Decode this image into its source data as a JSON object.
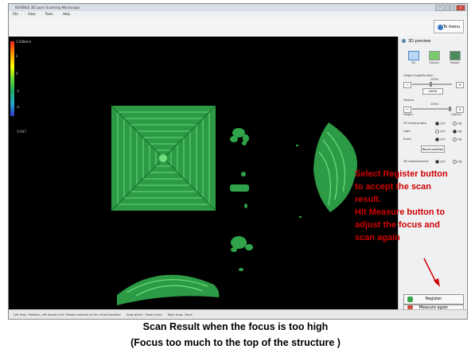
{
  "window": {
    "title": "KEYENCE 3D Laser Scanning Microscope",
    "menu": [
      "File",
      "View",
      "Tools",
      "Help"
    ],
    "to_menu_label": "To menu"
  },
  "scale": {
    "max": "3.508mm",
    "ticks": [
      "2",
      "0",
      "-2",
      "-4"
    ],
    "min": "-5.947"
  },
  "panel": {
    "title": "3D preview",
    "modes": [
      "3D",
      "Optical",
      "Height"
    ],
    "height_magnification_label": "Height magnification",
    "height_magnification_value": "100%",
    "height_magnification_button": "100%",
    "texture_label": "Texture",
    "texture_value": "100%",
    "texture_left": "Height",
    "texture_right": "Optical",
    "fill_missing_label": "Fill missing data",
    "light_label": "Light",
    "scale_label": "Scale",
    "off": "OFF",
    "on": "ON",
    "reset_label": "Reset position",
    "measurement_label": "3D measurement",
    "register_label": "Register",
    "measure_again_label": "Measure again"
  },
  "status": {
    "left_drag": "Left drag : Rotation, left double-click: Rotate centered on the clicked position",
    "wheel": "Drag wheel : Zoom in/out",
    "right_drag": "Right drag : Move"
  },
  "annotation": {
    "lines": [
      "Select Register button",
      "to accept the scan",
      "result.",
      "Hit Measure button to",
      "adjust the focus and",
      "scan again"
    ]
  },
  "caption": {
    "line1": "Scan Result when the focus is too high",
    "line2": "(Focus too much to the top of the structure )"
  },
  "colors": {
    "accent_red": "#d00000",
    "scan_green": "#2fa44a"
  }
}
